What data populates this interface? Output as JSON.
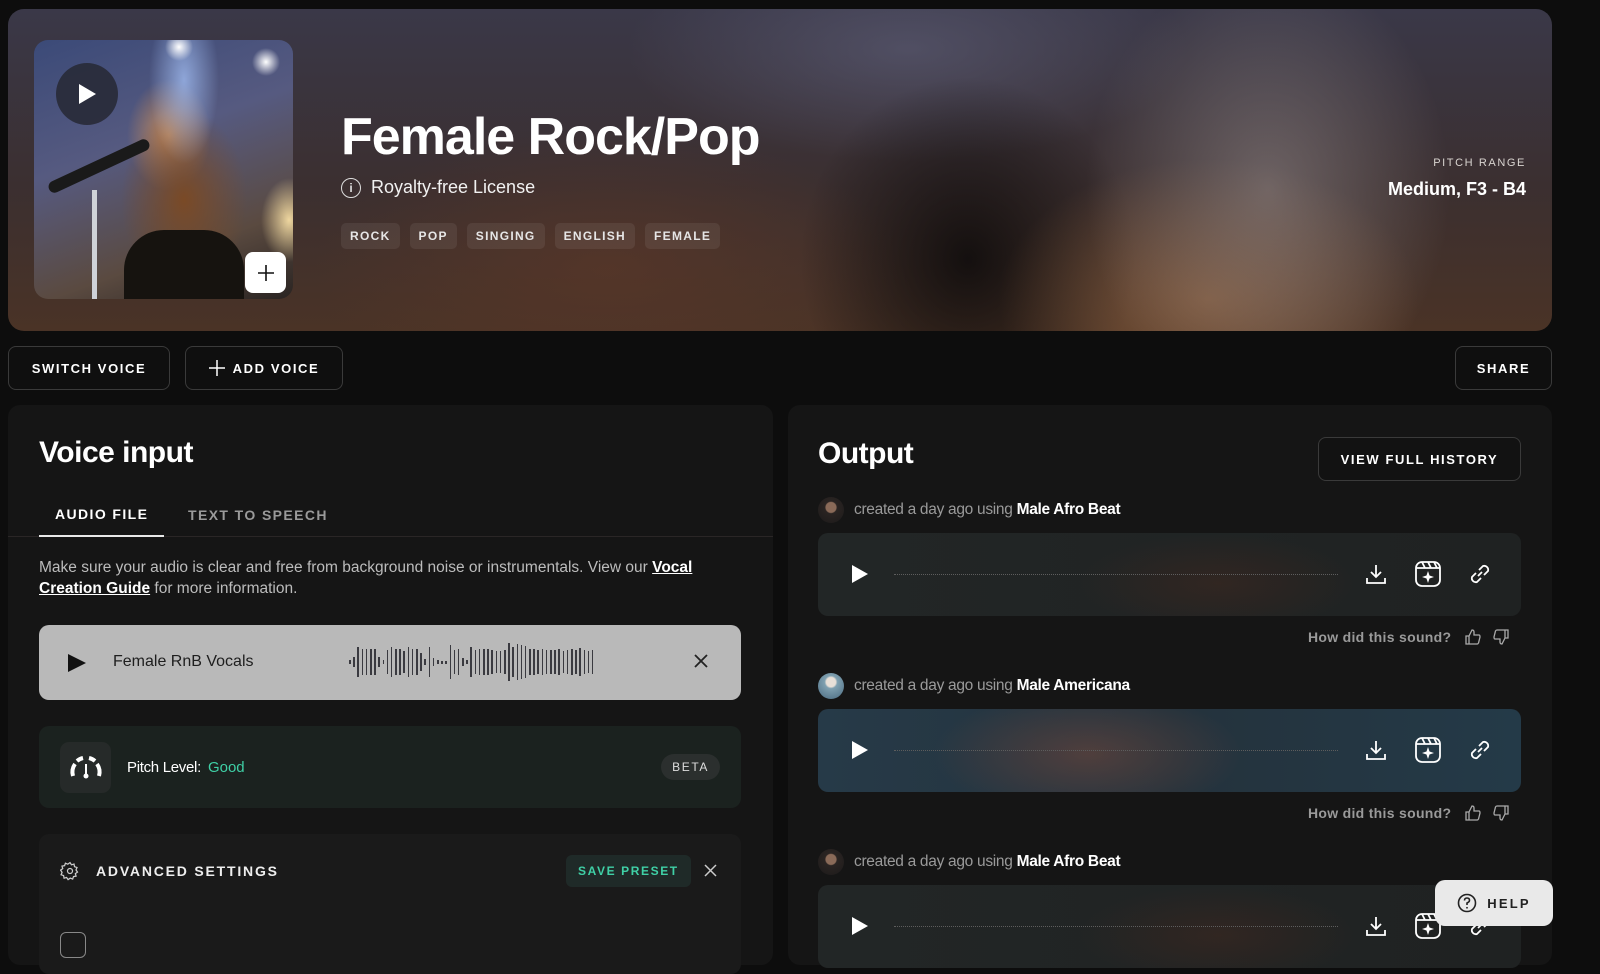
{
  "voice": {
    "title": "Female Rock/Pop",
    "license": "Royalty-free License",
    "tags": [
      "ROCK",
      "POP",
      "SINGING",
      "ENGLISH",
      "FEMALE"
    ],
    "pitch_range_label": "PITCH RANGE",
    "pitch_range_value": "Medium, F3 - B4",
    "add_label": "+"
  },
  "actions": {
    "switch_voice": "SWITCH VOICE",
    "add_voice": "ADD VOICE",
    "share": "SHARE"
  },
  "voice_input": {
    "title": "Voice input",
    "tabs": [
      {
        "label": "AUDIO FILE",
        "active": true
      },
      {
        "label": "TEXT TO SPEECH",
        "active": false
      }
    ],
    "description_prefix": "Make sure your audio is clear and free from background noise or instrumentals. View our ",
    "guide_link": "Vocal Creation Guide",
    "description_suffix": " for more information.",
    "audio_file": {
      "name": "Female RnB Vocals",
      "close_icon": "×"
    },
    "pitch_level": {
      "label": "Pitch Level:",
      "value": "Good",
      "value_color": "#3fd0a6",
      "badge": "BETA"
    },
    "advanced": {
      "label": "ADVANCED SETTINGS",
      "save_preset": "SAVE PRESET",
      "close_icon": "×"
    }
  },
  "output": {
    "title": "Output",
    "view_history": "VIEW FULL HISTORY",
    "feedback_prompt": "How did this sound?",
    "items": [
      {
        "prefix": "created a day ago using",
        "voice": "Male Afro Beat"
      },
      {
        "prefix": "created a day ago using",
        "voice": "Male Americana"
      },
      {
        "prefix": "created a day ago using",
        "voice": "Male Afro Beat"
      }
    ]
  },
  "help": {
    "label": "HELP"
  },
  "colors": {
    "accent": "#3fd0a6",
    "background": "#0d0d0d",
    "panel": "#151515"
  }
}
